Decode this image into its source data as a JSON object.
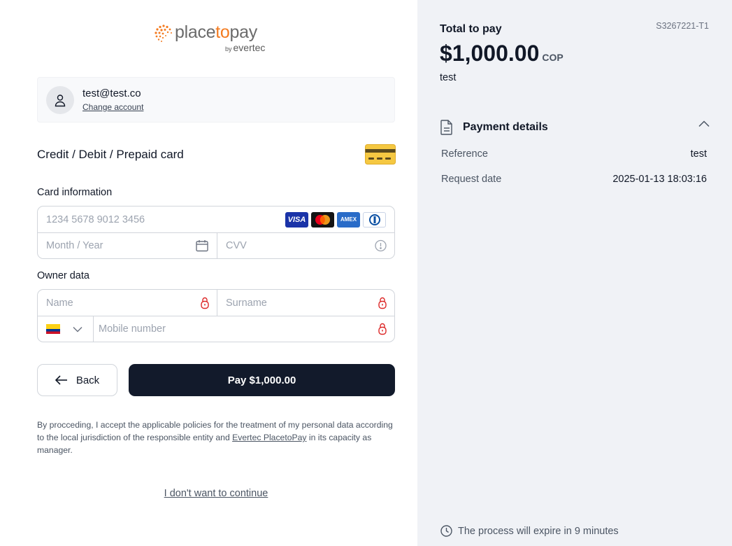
{
  "logo": {
    "brand_place": "place",
    "brand_to": "to",
    "brand_pay": "pay",
    "by": "by",
    "partner": "evertec"
  },
  "account": {
    "email": "test@test.co",
    "change_label": "Change account"
  },
  "payment_method": {
    "title": "Credit / Debit / Prepaid card"
  },
  "card_info": {
    "label": "Card information",
    "number_placeholder": "1234 5678 9012 3456",
    "expiry_placeholder": "Month / Year",
    "cvv_placeholder": "CVV",
    "brands": {
      "visa": "VISA",
      "amex": "AMEX"
    }
  },
  "owner": {
    "label": "Owner data",
    "name_placeholder": "Name",
    "surname_placeholder": "Surname",
    "mobile_placeholder": "Mobile number"
  },
  "actions": {
    "back_label": "Back",
    "pay_label": "Pay $1,000.00"
  },
  "terms": {
    "before": "By procceding, I accept the applicable policies for the treatment of my personal data according to the local jurisdiction of the responsible entity and ",
    "link": "Evertec PlacetoPay",
    "after": " in its capacity as manager."
  },
  "cancel_label": "I don't want to continue",
  "summary": {
    "total_label": "Total to pay",
    "ref_code": "S3267221-T1",
    "amount": "$1,000.00",
    "currency": "COP",
    "description": "test"
  },
  "details": {
    "title": "Payment details",
    "rows": [
      {
        "key": "Reference",
        "value": "test"
      },
      {
        "key": "Request date",
        "value": "2025-01-13 18:03:16"
      }
    ]
  },
  "expiry_notice": "The process will expire in 9 minutes",
  "colors": {
    "primary_button": "#121a2b",
    "brand_orange": "#f47b20",
    "panel_bg": "#f0f2f6",
    "required_icon": "#dc2626"
  }
}
